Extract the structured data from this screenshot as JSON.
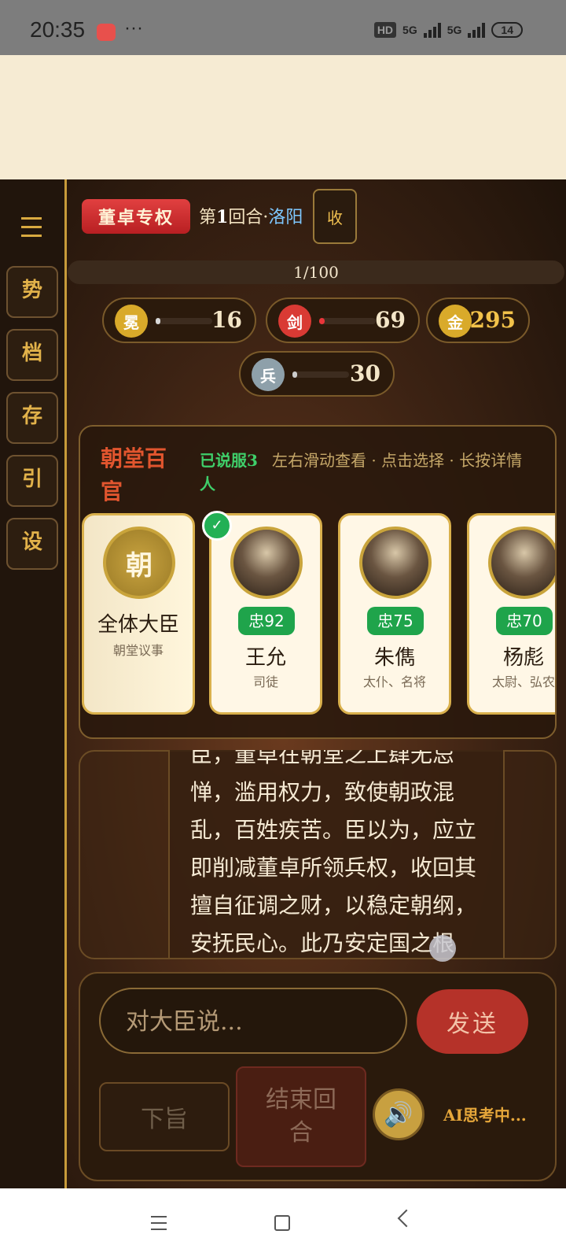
{
  "status_bar": {
    "time": "20:35",
    "more": "···",
    "hd": "HD",
    "net1": "5G",
    "net2": "5G",
    "battery": "14"
  },
  "game": {
    "faction_label": "董卓专权",
    "round_prefix": "第",
    "round_number": "1",
    "round_suffix": "回合·",
    "city": "洛阳",
    "collapse_label": "收",
    "progress_text": "1/100",
    "progress_fraction": 0.01
  },
  "sidebar": {
    "items": [
      {
        "label": "势"
      },
      {
        "label": "档"
      },
      {
        "label": "存"
      },
      {
        "label": "引"
      },
      {
        "label": "设"
      }
    ]
  },
  "stats": [
    {
      "icon_char": "冕",
      "value": "16",
      "fraction": 0.03,
      "coin_color": "#d9aa2a",
      "fill_color": "#d8d8d8"
    },
    {
      "icon_char": "剑",
      "value": "69",
      "fraction": 0.1,
      "coin_color": "#d93a34",
      "fill_color": "#e8353a"
    },
    {
      "icon_char": "金",
      "value": "295",
      "coin_color": "#d9aa2a"
    },
    {
      "icon_char": "兵",
      "value": "30",
      "fraction": 0.0,
      "coin_color": "#8ea0aa",
      "fill_color": "#cccccc"
    }
  ],
  "panel": {
    "title": "朝堂百官",
    "persuaded": "已说服3人",
    "hint": "左右滑动查看 · 点击选择 · 长按详情",
    "cards": [
      {
        "emblem": "朝",
        "name": "全体大臣",
        "title": "朝堂议事"
      },
      {
        "loyalty": "忠92",
        "name": "王允",
        "title": "司徒",
        "checked": true
      },
      {
        "loyalty": "忠75",
        "name": "朱儁",
        "title": "太仆、名将"
      },
      {
        "loyalty": "忠70",
        "name": "杨彪",
        "title": "太尉、弘农"
      }
    ]
  },
  "dialog": {
    "text": "臣，董卓在朝堂之上肆无忌惮，滥用权力，致使朝政混乱，百姓疾苦。臣以为，应立即削减董卓所领兵权，收回其擅自征调之财，以稳定朝纲，安抚民心。此乃安定国之根"
  },
  "controls": {
    "input_placeholder": "对大臣说...",
    "send_label": "发送",
    "decree_label": "下旨",
    "end_round_label": "结束回合",
    "speaker_icon": "speaker-icon",
    "ai_status": "AI思考中..."
  }
}
